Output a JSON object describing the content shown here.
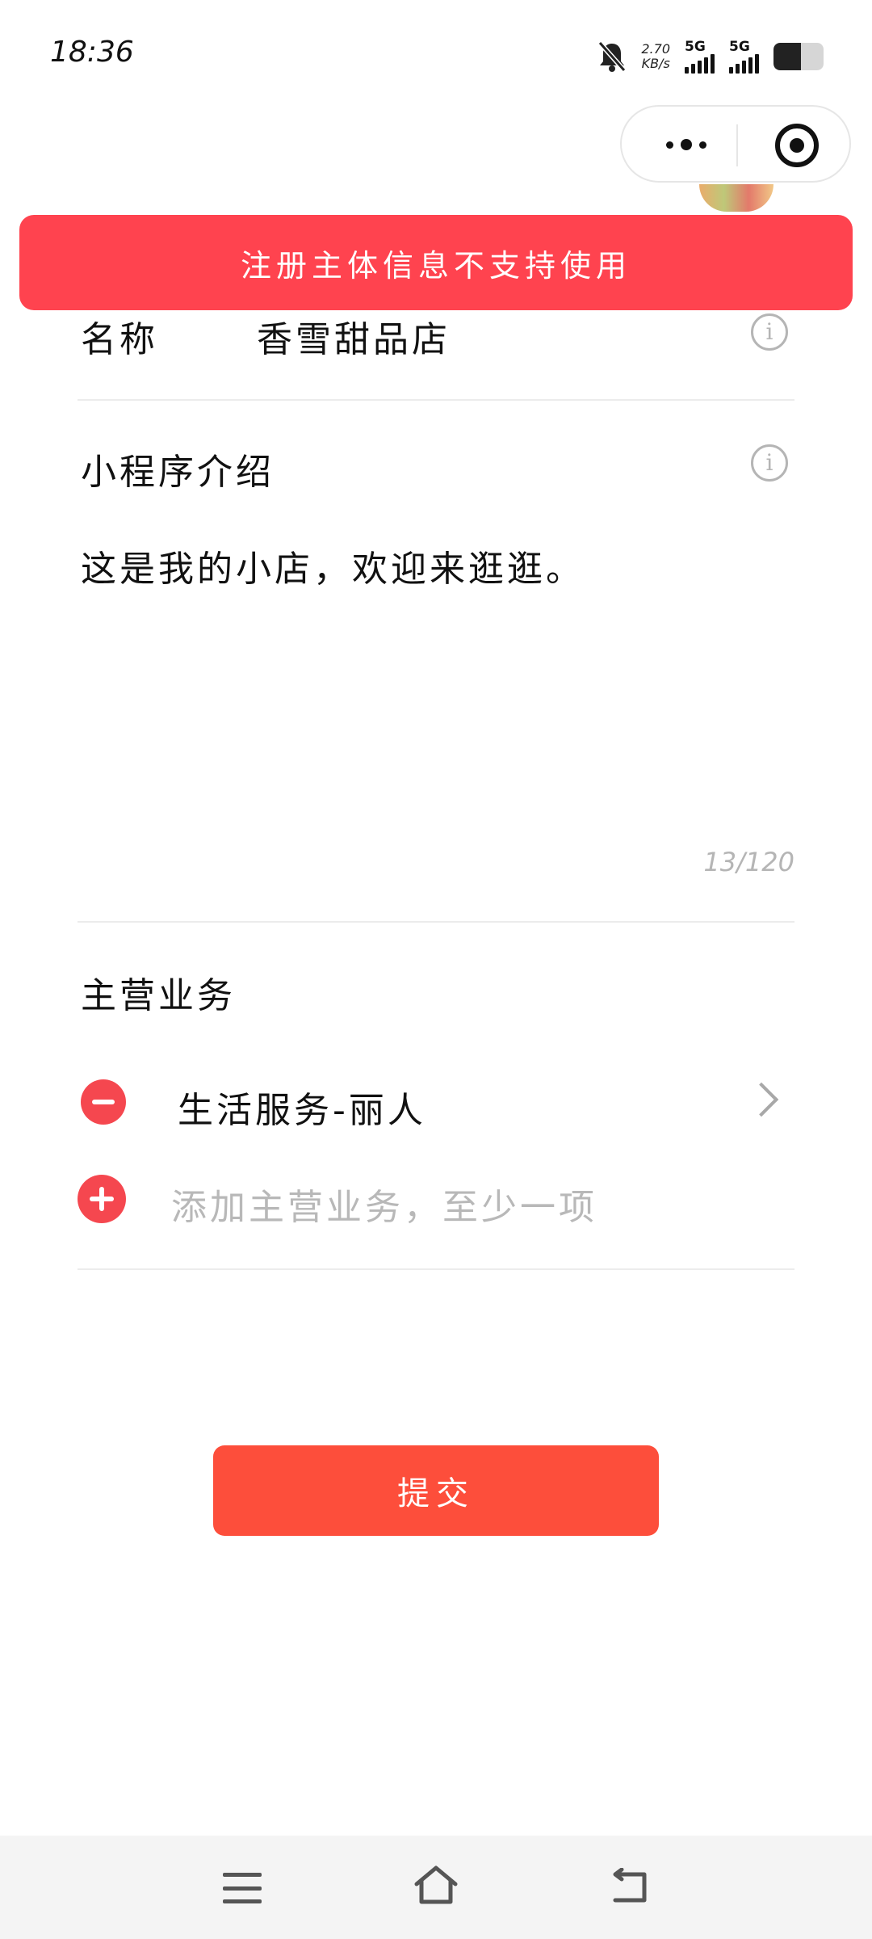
{
  "status_bar": {
    "time": "18:36",
    "net_speed_value": "2.70",
    "net_speed_unit": "KB/s",
    "signal_1_label": "5G",
    "signal_2_label": "5G",
    "battery_level": 0.55,
    "icons": [
      "bell-muted-icon",
      "signal-icon",
      "battery-icon"
    ]
  },
  "capsule": {
    "more_icon": "more-dots-icon",
    "close_icon": "target-circle-icon"
  },
  "toast": {
    "message": "注册主体信息不支持使用",
    "color": "#ff434f"
  },
  "form": {
    "name_label": "名称",
    "name_value": "香雪甜品店",
    "intro_label": "小程序介绍",
    "intro_text": "这是我的小店，欢迎来逛逛。",
    "intro_counter": "13/120",
    "business_label": "主营业务",
    "business_item": "生活服务-丽人",
    "add_business_placeholder": "添加主营业务，至少一项",
    "info_glyph": "i"
  },
  "submit": {
    "label": "提交",
    "color": "#fd4e3b"
  },
  "system_nav": {
    "icons": [
      "menu-icon",
      "home-icon",
      "back-icon"
    ]
  }
}
